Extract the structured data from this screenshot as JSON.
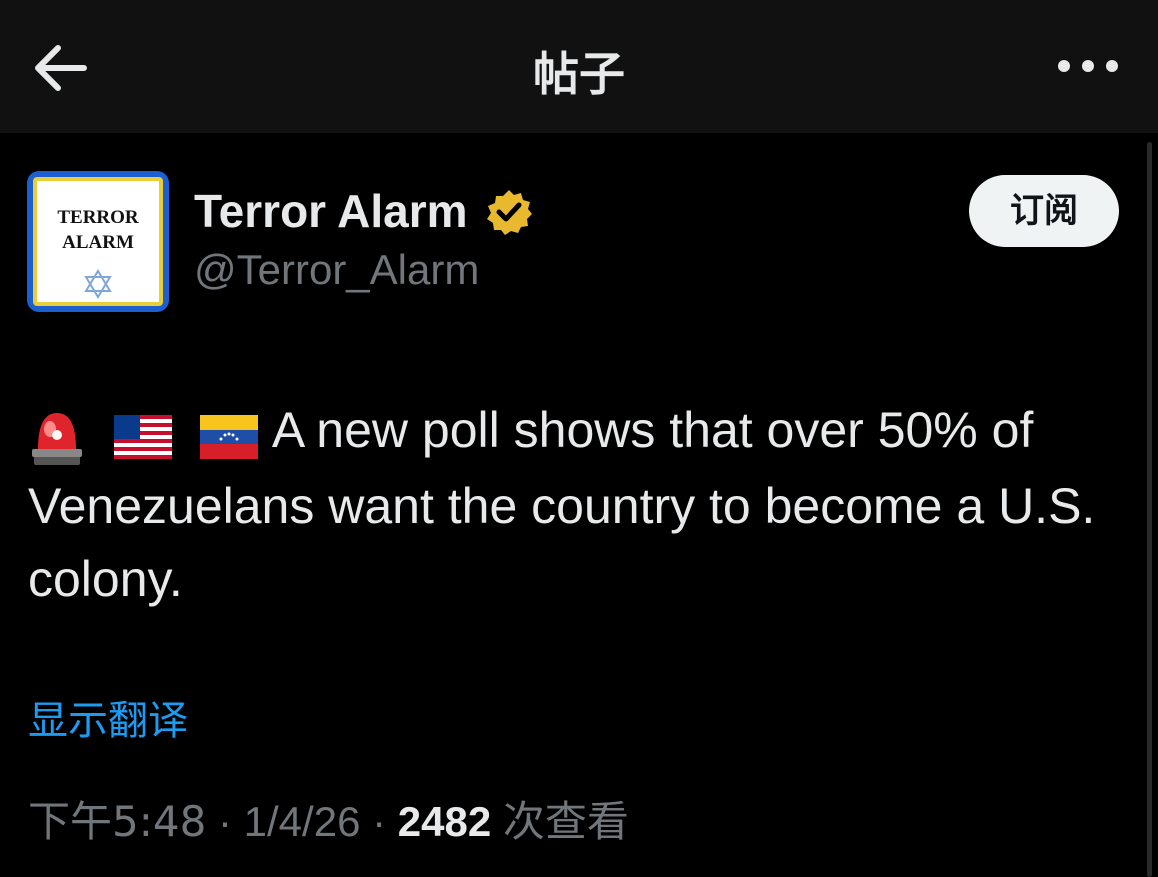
{
  "header": {
    "title": "帖子",
    "back_icon": "arrow-left-icon",
    "more_icon": "more-horizontal-icon"
  },
  "author": {
    "display_name": "Terror Alarm",
    "handle": "@Terror_Alarm",
    "avatar_text": "TERROR\nALARM",
    "verified_icon": "verified-badge-icon",
    "verified_color": "#e8b82f"
  },
  "actions": {
    "subscribe_label": "订阅"
  },
  "tweet": {
    "emojis": [
      "siren-emoji",
      "us-flag-emoji",
      "venezuela-flag-emoji"
    ],
    "text": "A new poll shows that over 50% of Venezuelans want the country to become a U.S. colony."
  },
  "translate_label": "显示翻译",
  "meta": {
    "time": "下午5:48",
    "separator": " · ",
    "date": "1/4/26",
    "views_count": "2482",
    "views_label": "次查看"
  },
  "colors": {
    "background": "#000000",
    "header_bg": "#111111",
    "text": "#e7e9ea",
    "muted": "#71767b",
    "link": "#1d9bf0"
  }
}
